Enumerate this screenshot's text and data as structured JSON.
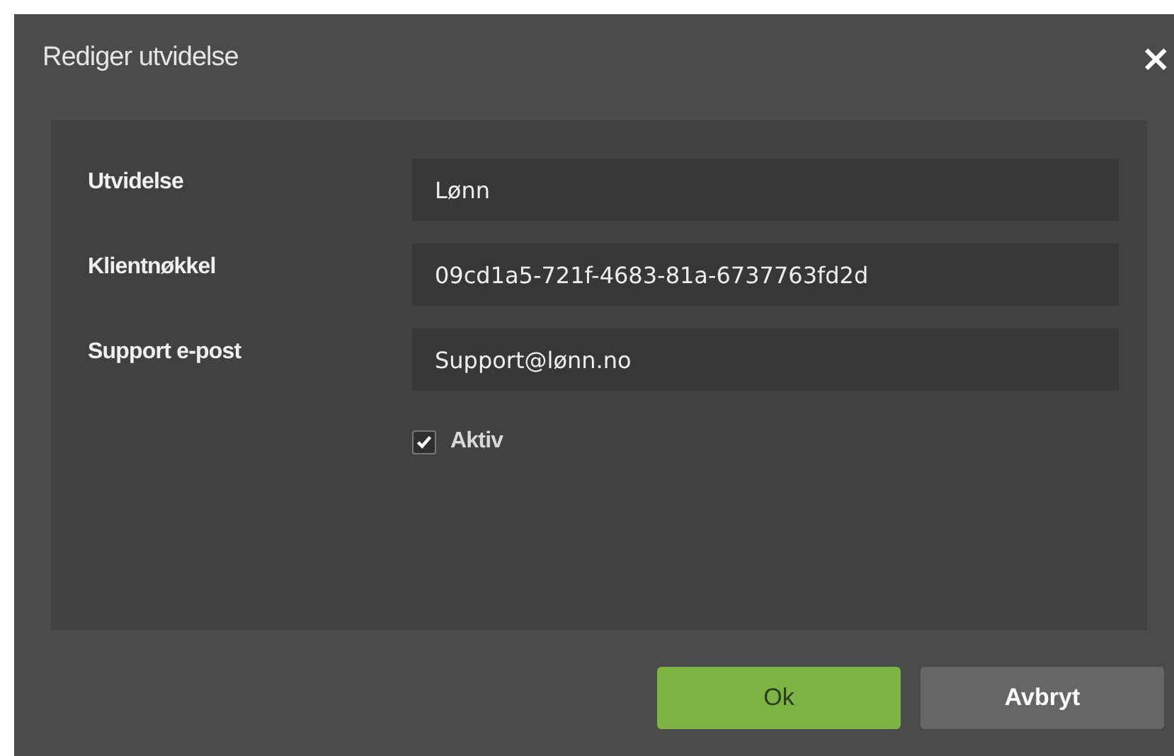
{
  "dialog": {
    "title": "Rediger utvidelse",
    "close": "×"
  },
  "fields": [
    {
      "label": "Utvidelse",
      "value": "Lønn"
    },
    {
      "label": "Klientnøkkel",
      "value": "09cd1a5-721f-4683-81a-6737763fd2d"
    },
    {
      "label": "Support e-post",
      "value": "Support@lønn.no"
    }
  ],
  "checkbox": {
    "label": "Aktiv",
    "checked": true
  },
  "buttons": [
    {
      "label": "Ok",
      "kind": "primary"
    },
    {
      "label": "Avbryt",
      "kind": "secondary"
    }
  ]
}
